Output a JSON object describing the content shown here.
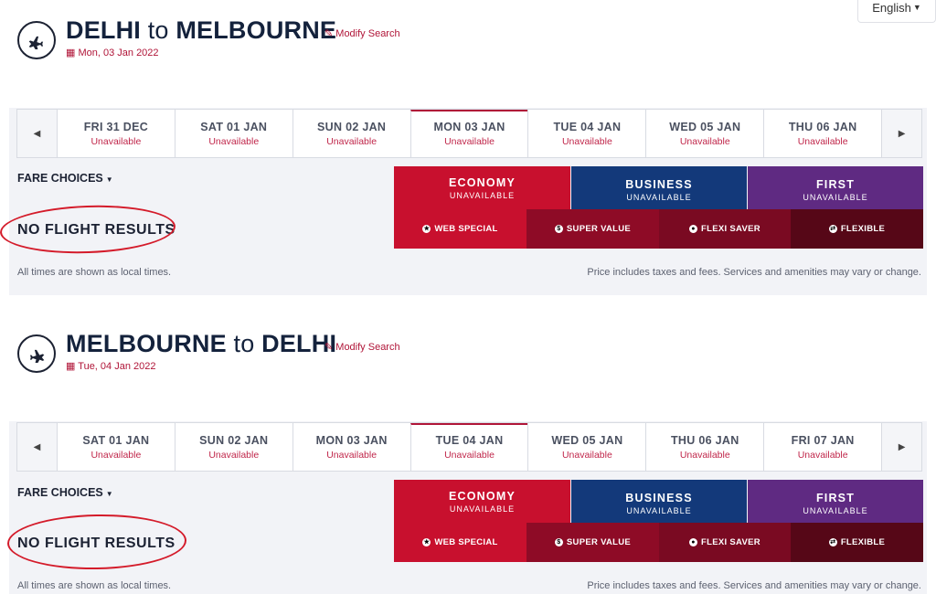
{
  "language": {
    "label": "English"
  },
  "legs": [
    {
      "origin": "DELHI",
      "connector": "to",
      "destination": "MELBOURNE",
      "modify": "Modify Search",
      "date": "Mon, 03 Jan 2022",
      "plane_icon": "plane-departure-icon",
      "days": [
        {
          "label": "FRI 31 DEC",
          "status": "Unavailable"
        },
        {
          "label": "SAT 01 JAN",
          "status": "Unavailable"
        },
        {
          "label": "SUN 02 JAN",
          "status": "Unavailable"
        },
        {
          "label": "MON 03 JAN",
          "status": "Unavailable"
        },
        {
          "label": "TUE 04 JAN",
          "status": "Unavailable"
        },
        {
          "label": "WED 05 JAN",
          "status": "Unavailable"
        },
        {
          "label": "THU 06 JAN",
          "status": "Unavailable"
        }
      ],
      "active_day": 3,
      "fare_choices": "FARE CHOICES",
      "no_results": "NO FLIGHT RESULTS",
      "cabins": [
        {
          "name": "ECONOMY",
          "status": "UNAVAILABLE"
        },
        {
          "name": "BUSINESS",
          "status": "UNAVAILABLE"
        },
        {
          "name": "FIRST",
          "status": "UNAVAILABLE"
        }
      ],
      "fares": [
        "WEB SPECIAL",
        "SUPER VALUE",
        "FLEXI SAVER",
        "FLEXIBLE"
      ],
      "note_left": "All times are shown as local times.",
      "note_right": "Price includes taxes and fees. Services and amenities may vary or change."
    },
    {
      "origin": "MELBOURNE",
      "connector": "to",
      "destination": "DELHI",
      "modify": "Modify Search",
      "date": "Tue, 04 Jan 2022",
      "plane_icon": "plane-arrival-icon",
      "days": [
        {
          "label": "SAT 01 JAN",
          "status": "Unavailable"
        },
        {
          "label": "SUN 02 JAN",
          "status": "Unavailable"
        },
        {
          "label": "MON 03 JAN",
          "status": "Unavailable"
        },
        {
          "label": "TUE 04 JAN",
          "status": "Unavailable"
        },
        {
          "label": "WED 05 JAN",
          "status": "Unavailable"
        },
        {
          "label": "THU 06 JAN",
          "status": "Unavailable"
        },
        {
          "label": "FRI 07 JAN",
          "status": "Unavailable"
        }
      ],
      "active_day": 3,
      "fare_choices": "FARE CHOICES",
      "no_results": "NO FLIGHT RESULTS",
      "cabins": [
        {
          "name": "ECONOMY",
          "status": "UNAVAILABLE"
        },
        {
          "name": "BUSINESS",
          "status": "UNAVAILABLE"
        },
        {
          "name": "FIRST",
          "status": "UNAVAILABLE"
        }
      ],
      "fares": [
        "WEB SPECIAL",
        "SUPER VALUE",
        "FLEXI SAVER",
        "FLEXIBLE"
      ],
      "note_left": "All times are shown as local times.",
      "note_right": "Price includes taxes and fees. Services and amenities may vary or change."
    }
  ],
  "colors": {
    "economy": "#c8102e",
    "business": "#13397a",
    "first": "#5f2a82",
    "accent": "#b01538",
    "annotation": "#d41b2a"
  }
}
